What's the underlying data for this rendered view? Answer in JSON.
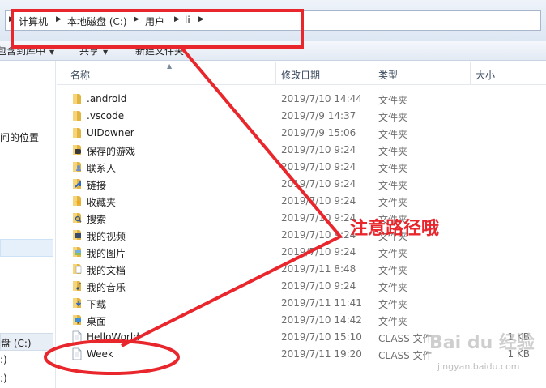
{
  "address": {
    "crumbs": [
      "计算机",
      "本地磁盘 (C:)",
      "用户",
      "li"
    ]
  },
  "toolbar": {
    "include_in_library": "包含到库中",
    "share": "共享",
    "new_folder": "新建文件夹"
  },
  "nav": {
    "recent_places": "问的位置",
    "local_disk": "盘 (C:)",
    "drive_d": ":)",
    "drive_e": ":)"
  },
  "columns": {
    "name": "名称",
    "modified": "修改日期",
    "type": "类型",
    "size": "大小"
  },
  "files": [
    {
      "name": ".android",
      "date": "2019/7/10 14:44",
      "type": "文件夹",
      "size": "",
      "icon": "folder-icon"
    },
    {
      "name": ".vscode",
      "date": "2019/7/9 14:37",
      "type": "文件夹",
      "size": "",
      "icon": "folder-icon"
    },
    {
      "name": "UIDowner",
      "date": "2019/7/9 15:06",
      "type": "文件夹",
      "size": "",
      "icon": "folder-icon"
    },
    {
      "name": "保存的游戏",
      "date": "2019/7/10 9:24",
      "type": "文件夹",
      "size": "",
      "icon": "saved-games-icon"
    },
    {
      "name": "联系人",
      "date": "2019/7/10 9:24",
      "type": "文件夹",
      "size": "",
      "icon": "contacts-icon"
    },
    {
      "name": "链接",
      "date": "2019/7/10 9:24",
      "type": "文件夹",
      "size": "",
      "icon": "links-icon"
    },
    {
      "name": "收藏夹",
      "date": "2019/7/10 9:24",
      "type": "文件夹",
      "size": "",
      "icon": "favorites-icon"
    },
    {
      "name": "搜索",
      "date": "2019/7/10 9:24",
      "type": "文件夹",
      "size": "",
      "icon": "searches-icon"
    },
    {
      "name": "我的视频",
      "date": "2019/7/10 9:24",
      "type": "文件夹",
      "size": "",
      "icon": "videos-icon"
    },
    {
      "name": "我的图片",
      "date": "2019/7/10 9:24",
      "type": "文件夹",
      "size": "",
      "icon": "pictures-icon"
    },
    {
      "name": "我的文档",
      "date": "2019/7/11 8:48",
      "type": "文件夹",
      "size": "",
      "icon": "documents-icon"
    },
    {
      "name": "我的音乐",
      "date": "2019/7/10 9:24",
      "type": "文件夹",
      "size": "",
      "icon": "music-icon"
    },
    {
      "name": "下载",
      "date": "2019/7/11 11:41",
      "type": "文件夹",
      "size": "",
      "icon": "downloads-icon"
    },
    {
      "name": "桌面",
      "date": "2019/7/10 14:42",
      "type": "文件夹",
      "size": "",
      "icon": "desktop-icon"
    },
    {
      "name": "HelloWorld",
      "date": "2019/7/10 15:10",
      "type": "CLASS 文件",
      "size": "1 KB",
      "icon": "file-icon"
    },
    {
      "name": "Week",
      "date": "2019/7/11 19:20",
      "type": "CLASS 文件",
      "size": "1 KB",
      "icon": "file-icon"
    }
  ],
  "annotation": {
    "note": "注意路径哦",
    "color": "#e8262c"
  },
  "watermark": {
    "logo": "Bai du 经验",
    "url": "jingyan.baidu.com"
  }
}
